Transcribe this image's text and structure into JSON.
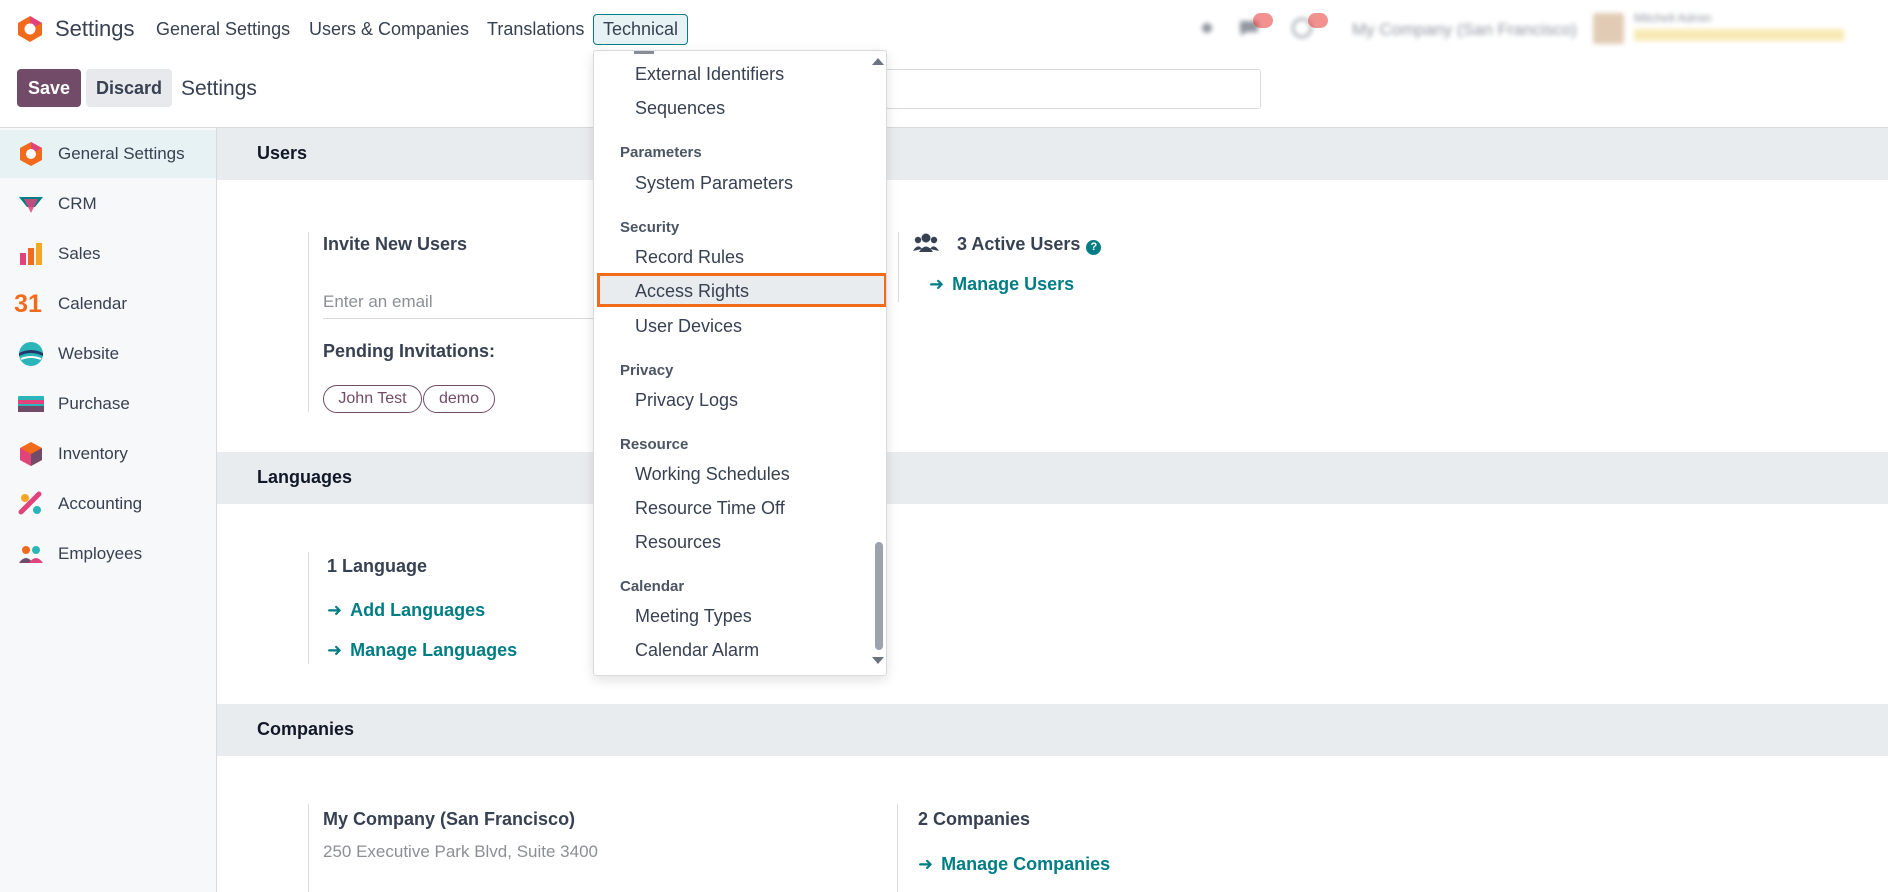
{
  "navbar": {
    "app_title": "Settings",
    "menu": [
      "General Settings",
      "Users & Companies",
      "Translations",
      "Technical"
    ],
    "company": "My Company (San Francisco)",
    "user_name": "Mitchell Admin"
  },
  "control": {
    "save_label": "Save",
    "discard_label": "Discard",
    "title": "Settings"
  },
  "sidebar": {
    "items": [
      {
        "label": "General Settings",
        "icon": "settings-icon"
      },
      {
        "label": "CRM",
        "icon": "crm-icon"
      },
      {
        "label": "Sales",
        "icon": "sales-icon"
      },
      {
        "label": "Calendar",
        "icon": "calendar-icon"
      },
      {
        "label": "Website",
        "icon": "website-icon"
      },
      {
        "label": "Purchase",
        "icon": "purchase-icon"
      },
      {
        "label": "Inventory",
        "icon": "inventory-icon"
      },
      {
        "label": "Accounting",
        "icon": "accounting-icon"
      },
      {
        "label": "Employees",
        "icon": "employees-icon"
      }
    ],
    "calendar_icon_text": "31"
  },
  "users": {
    "title": "Users",
    "invite_label": "Invite New Users",
    "email_placeholder": "Enter an email",
    "pending_label": "Pending Invitations:",
    "pending": [
      "John Test",
      "demo"
    ],
    "active_users": "3 Active Users",
    "manage_users": "Manage Users"
  },
  "languages": {
    "title": "Languages",
    "count": "1 Language",
    "add": "Add Languages",
    "manage": "Manage Languages"
  },
  "companies": {
    "title": "Companies",
    "company_name": "My Company (San Francisco)",
    "company_address": "250 Executive Park Blvd, Suite 3400",
    "count": "2 Companies",
    "manage": "Manage Companies"
  },
  "dropdown": {
    "items": {
      "external_identifiers": "External Identifiers",
      "sequences": "Sequences",
      "parameters": "Parameters",
      "system_parameters": "System Parameters",
      "security": "Security",
      "record_rules": "Record Rules",
      "access_rights": "Access Rights",
      "user_devices": "User Devices",
      "privacy": "Privacy",
      "privacy_logs": "Privacy Logs",
      "resource": "Resource",
      "working_schedules": "Working Schedules",
      "resource_time_off": "Resource Time Off",
      "resources": "Resources",
      "calendar": "Calendar",
      "meeting_types": "Meeting Types",
      "calendar_alarm": "Calendar Alarm"
    }
  },
  "colors": {
    "brand": "#714b67",
    "accent": "#017e84",
    "highlight": "#f26b1d"
  }
}
